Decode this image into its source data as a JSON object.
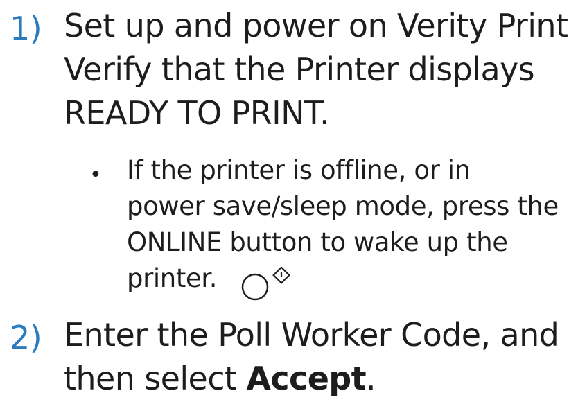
{
  "steps": [
    {
      "number": "1)",
      "lines": [
        "Set up and power on Verity Print",
        "Verify that the Printer displays",
        "READY TO PRINT."
      ],
      "sub_items": [
        {
          "bullet": "•",
          "lines": [
            "If the printer is offline, or in",
            "power save/sleep mode, press the",
            "ONLINE button to wake up the",
            "printer."
          ],
          "icon": "online-button-icon"
        }
      ]
    },
    {
      "number": "2)",
      "lines": [
        "Enter the Poll Worker Code, and"
      ],
      "line2_prefix": "then select ",
      "line2_bold": "Accept",
      "line2_suffix": "."
    }
  ],
  "colors": {
    "number_color": "#2b7bbf",
    "text_color": "#1d1d1d",
    "background": "#ffffff"
  }
}
